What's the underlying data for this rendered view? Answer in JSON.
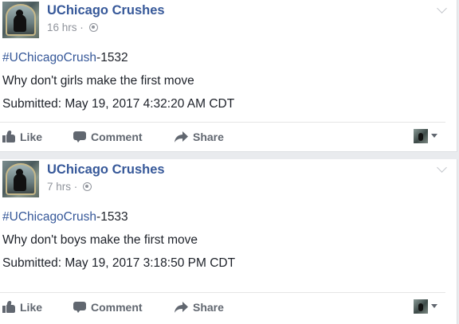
{
  "posts": [
    {
      "page_name": "UChicago Crushes",
      "time": "16 hrs",
      "separator": "·",
      "privacy_icon": "globe-icon",
      "hashtag": "#UChicagoCrush",
      "post_number": "-1532",
      "message": "Why don't girls make the first move",
      "submitted": "Submitted: May 19, 2017 4:32:20 AM CDT",
      "actions": {
        "like": "Like",
        "comment": "Comment",
        "share": "Share"
      }
    },
    {
      "page_name": "UChicago Crushes",
      "time": "7 hrs",
      "separator": "·",
      "privacy_icon": "globe-icon",
      "hashtag": "#UChicagoCrush",
      "post_number": "-1533",
      "message": "Why don't boys make the first move",
      "submitted": "Submitted: May 19, 2017 3:18:50 PM CDT",
      "actions": {
        "like": "Like",
        "comment": "Comment",
        "share": "Share"
      }
    }
  ],
  "colors": {
    "link_blue": "#365899",
    "text": "#1d2129",
    "meta_gray": "#90949c",
    "action_gray": "#616770",
    "background": "#e9ebee"
  }
}
